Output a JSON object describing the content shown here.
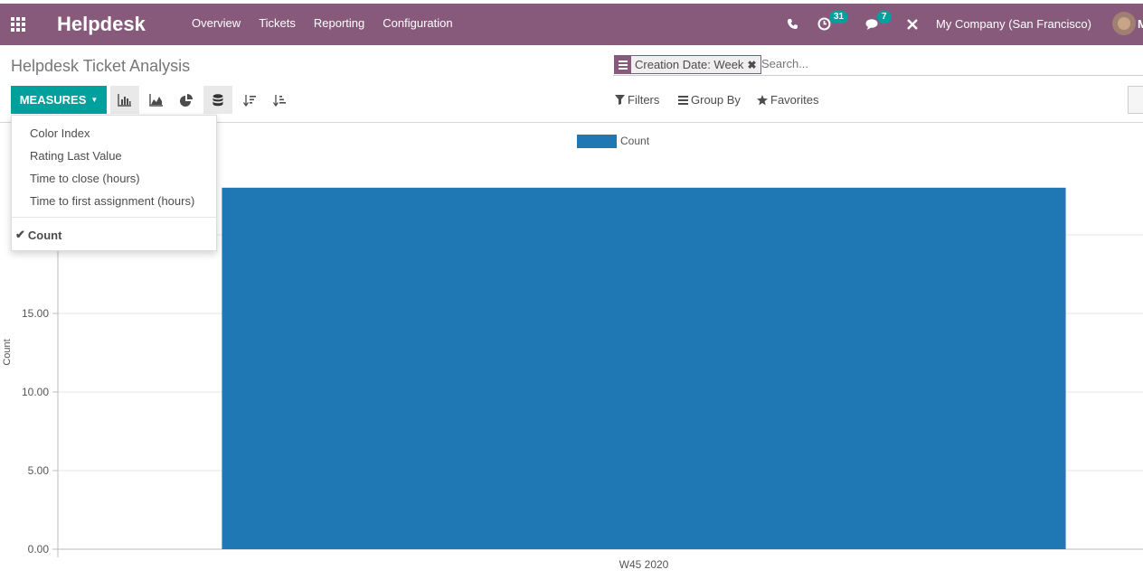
{
  "app": {
    "brand": "Helpdesk",
    "menu": [
      "Overview",
      "Tickets",
      "Reporting",
      "Configuration"
    ],
    "activity_count": "31",
    "message_count": "7",
    "company": "My Company (San Francisco)",
    "user_initial": "M"
  },
  "page": {
    "title": "Helpdesk Ticket Analysis"
  },
  "search": {
    "facet": "Creation Date: Week",
    "placeholder": "Search..."
  },
  "toolbar": {
    "measures_label": "MEASURES",
    "filters_label": "Filters",
    "groupby_label": "Group By",
    "favorites_label": "Favorites"
  },
  "measures_menu": {
    "items": [
      "Color Index",
      "Rating Last Value",
      "Time to close (hours)",
      "Time to first assignment (hours)"
    ],
    "checked_item": "Count"
  },
  "colors": {
    "header": "#875a7b",
    "accent": "#00a09d",
    "bar": "#1f77b4"
  },
  "chart_data": {
    "type": "bar",
    "categories": [
      "W45 2020"
    ],
    "series": [
      {
        "name": "Count",
        "values": [
          23
        ]
      }
    ],
    "ylabel": "Count",
    "xlabel": "",
    "yticks": [
      "0.00",
      "5.00",
      "10.00",
      "15.00"
    ],
    "ytick_values": [
      0,
      5,
      10,
      15
    ],
    "ylim": [
      0,
      24
    ],
    "legend": "top-center",
    "grid": true
  }
}
